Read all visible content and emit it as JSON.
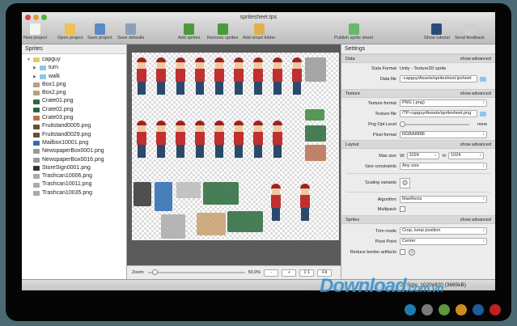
{
  "window": {
    "title": "spritesheet.tps"
  },
  "toolbar": [
    {
      "label": "New project",
      "icon": "new-document-icon",
      "color": "#f4f4f4"
    },
    {
      "label": "Open project",
      "icon": "folder-icon",
      "color": "#f0c050"
    },
    {
      "label": "Save project",
      "icon": "floppy-icon",
      "color": "#5a8ac8"
    },
    {
      "label": "Save defaults",
      "icon": "sliders-icon",
      "color": "#8aa0b8"
    },
    {
      "label": "Add sprites",
      "icon": "add-image-icon",
      "color": "#4a9a3a"
    },
    {
      "label": "Remove sprites",
      "icon": "remove-image-icon",
      "color": "#4a9a3a"
    },
    {
      "label": "Add smart folder",
      "icon": "smart-folder-icon",
      "color": "#e0b050"
    },
    {
      "label": "Publish sprite sheet",
      "icon": "publish-icon",
      "color": "#6ab86a"
    },
    {
      "label": "Show tutorial",
      "icon": "graduation-cap-icon",
      "color": "#2a4a7a"
    },
    {
      "label": "Send feedback",
      "icon": "speech-bubble-icon",
      "color": "#cfcfcf"
    }
  ],
  "sprites": {
    "title": "Sprites",
    "items": [
      {
        "label": "capguy",
        "icon": "folder-icon",
        "color": "#e8c860",
        "indent": 0,
        "toggle": "▼"
      },
      {
        "label": "turn",
        "icon": "folder-icon",
        "color": "#8cc8e8",
        "indent": 1,
        "toggle": "▶"
      },
      {
        "label": "walk",
        "icon": "folder-icon",
        "color": "#8cc8e8",
        "indent": 1,
        "toggle": "▶"
      },
      {
        "label": "Box1.png",
        "icon": "image-icon",
        "color": "#b8a080",
        "indent": 0
      },
      {
        "label": "Box2.png",
        "icon": "image-icon",
        "color": "#b8a080",
        "indent": 0
      },
      {
        "label": "Crate01.png",
        "icon": "image-icon",
        "color": "#2a6a3a",
        "indent": 0
      },
      {
        "label": "Crate02.png",
        "icon": "image-icon",
        "color": "#2a6a3a",
        "indent": 0
      },
      {
        "label": "Crate03.png",
        "icon": "image-icon",
        "color": "#b87050",
        "indent": 0
      },
      {
        "label": "Fruitstand0005.png",
        "icon": "image-icon",
        "color": "#6a5030",
        "indent": 0
      },
      {
        "label": "Fruitstand0029.png",
        "icon": "image-icon",
        "color": "#6a5030",
        "indent": 0
      },
      {
        "label": "Mailbox10001.png",
        "icon": "image-icon",
        "color": "#3a6ab0",
        "indent": 0
      },
      {
        "label": "NewspaperBox0001.png",
        "icon": "image-icon",
        "color": "#999999",
        "indent": 0
      },
      {
        "label": "NewspaperBox0016.png",
        "icon": "image-icon",
        "color": "#999999",
        "indent": 0
      },
      {
        "label": "StoreSign0001.png",
        "icon": "image-icon",
        "color": "#333333",
        "indent": 0
      },
      {
        "label": "Trashcan10006.png",
        "icon": "image-icon",
        "color": "#aaaaaa",
        "indent": 0
      },
      {
        "label": "Trashcan10011.png",
        "icon": "image-icon",
        "color": "#aaaaaa",
        "indent": 0
      },
      {
        "label": "Trashcan10035.png",
        "icon": "image-icon",
        "color": "#aaaaaa",
        "indent": 0
      }
    ]
  },
  "zoom": {
    "label": "Zoom:",
    "value": "50.0%",
    "level": 0.05,
    "minus": "-",
    "plus": "+",
    "one": "1:1",
    "fit": "Fit"
  },
  "settings": {
    "title": "Settings",
    "advanced": "show advanced",
    "data": {
      "title": "Data",
      "data_format_label": "Data Format",
      "data_format": "Unity - Texture2D sprite",
      "data_file_label": "Data file",
      "data_file": "-capguy/Assets/spritesheet.tpsheet"
    },
    "texture": {
      "title": "Texture",
      "format_label": "Texture format",
      "format": "PNG (.png)",
      "file_label": "Texture file",
      "file": "/TP-capguy/Assets/spritesheet.png",
      "png_opt_label": "Png Opt Level",
      "png_opt": "none",
      "pixel_label": "Pixel format",
      "pixel": "RGBA8888"
    },
    "layout": {
      "title": "Layout",
      "max_size_label": "Max size",
      "w_label": "W:",
      "w": "1024",
      "h_label": "H:",
      "h": "1024",
      "constraints_label": "Size constraints",
      "constraints": "Any size",
      "scaling_label": "Scaling variants",
      "algorithm_label": "Algorithm",
      "algorithm": "MaxRects",
      "multipack_label": "Multipack"
    },
    "sprites": {
      "title": "Sprites",
      "trim_label": "Trim mode",
      "trim": "Crop, keep position",
      "pivot_label": "Pivot Point",
      "pivot": "Center",
      "reduce_label": "Reduce border artifacts"
    }
  },
  "status": {
    "size": "Size: 1020x920 (3665kB)"
  },
  "watermark": {
    "text": "Download",
    "suffix": ".com.vn",
    "dots": [
      "#1f7ab0",
      "#7a7a7a",
      "#5a9a3a",
      "#d08a20",
      "#1f5a9a",
      "#c02020"
    ]
  }
}
